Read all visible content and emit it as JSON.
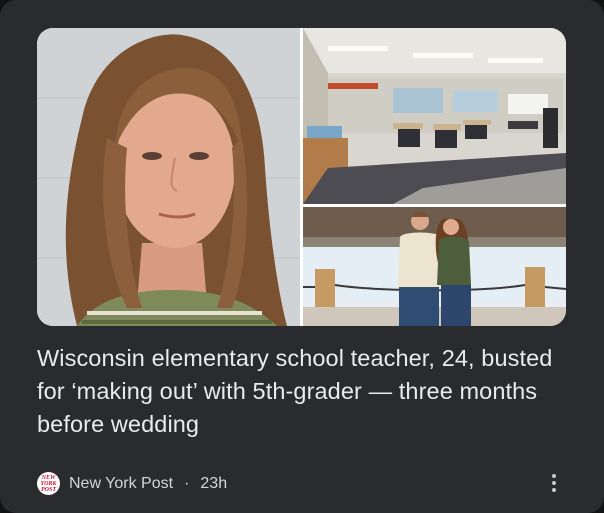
{
  "article": {
    "headline": "Wisconsin elementary school teacher, 24, busted for ‘making out’ with 5th-grader — three months before wedding",
    "publisher": {
      "logo_text_line1": "NEW",
      "logo_text_line2": "YORK",
      "logo_text_line3": "POST",
      "name": "New York Post",
      "separator": "·",
      "time": "23h"
    },
    "images": [
      {
        "icon": "portrait-photo"
      },
      {
        "icon": "classroom-photo"
      },
      {
        "icon": "couple-lakeside-photo"
      }
    ]
  },
  "menu_icon": "more-vertical-icon",
  "colors": {
    "card_background": "#2a2b2e",
    "text_primary": "#e8eaed",
    "text_secondary": "#d3d5d8",
    "logo_red": "#c8102e"
  }
}
